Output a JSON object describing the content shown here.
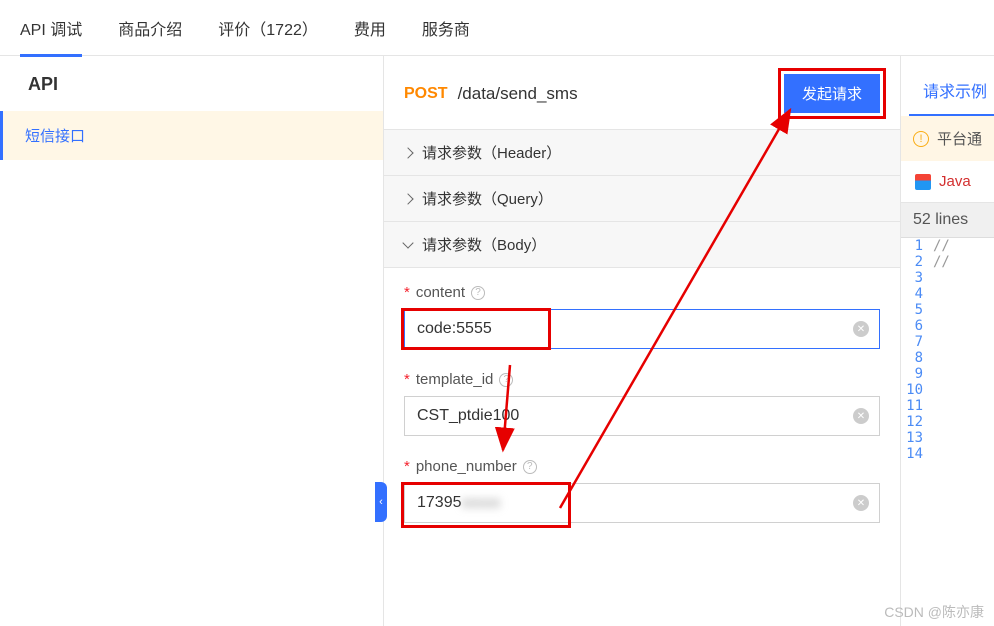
{
  "top_tabs": {
    "debug": "API 调试",
    "intro": "商品介绍",
    "reviews": "评价（1722）",
    "cost": "费用",
    "provider": "服务商"
  },
  "sidebar": {
    "header": "API",
    "item_sms": "短信接口"
  },
  "endpoint": {
    "method": "POST",
    "path": "/data/send_sms",
    "send_button": "发起请求"
  },
  "accordion": {
    "header": "请求参数（Header）",
    "query": "请求参数（Query）",
    "body": "请求参数（Body）"
  },
  "fields": {
    "content": {
      "label": "content",
      "value": "code:5555"
    },
    "template_id": {
      "label": "template_id",
      "value": "CST_ptdie100"
    },
    "phone_number": {
      "label": "phone_number",
      "value": "17395",
      "masked": "00000"
    }
  },
  "right": {
    "examples": "请求示例",
    "platform_notice": "平台通",
    "java": "Java",
    "lines_header": "52 lines",
    "code_fragments": {
      "l1": "//",
      "l2": "//"
    }
  },
  "watermark": "CSDN @陈亦康"
}
